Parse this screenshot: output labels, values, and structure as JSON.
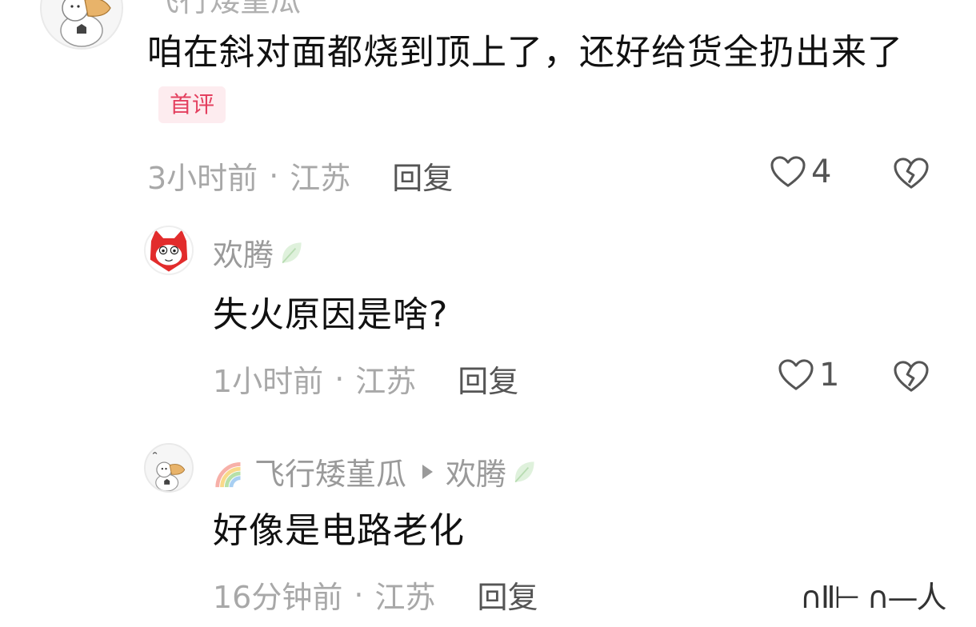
{
  "comment1": {
    "author_partial": "飞行矮堇瓜",
    "text": "咱在斜对面都烧到顶上了，还好给货全扔出来了",
    "badge": "首评",
    "time": "3小时前",
    "location": "江苏",
    "reply_label": "回复",
    "likes": "4"
  },
  "reply1": {
    "author": "欢腾",
    "text": "失火原因是啥?",
    "time": "1小时前",
    "location": "江苏",
    "reply_label": "回复",
    "likes": "1"
  },
  "reply2": {
    "author": "飞行矮堇瓜",
    "reply_to": "欢腾",
    "text": "好像是电路老化",
    "time": "16分钟前",
    "location": "江苏",
    "reply_label": "回复",
    "partial_cut_text": "∩Ⅱ⊢ ∩—人"
  },
  "separator": "·",
  "colors": {
    "badge_text": "#e4405f",
    "badge_bg": "#fdecef",
    "meta_text": "#a8a8a8",
    "name_text": "#9a9a9a"
  },
  "icons": [
    "heart-outline-icon",
    "broken-heart-icon",
    "leaf-icon",
    "rainbow-icon",
    "triangle-right-icon"
  ]
}
